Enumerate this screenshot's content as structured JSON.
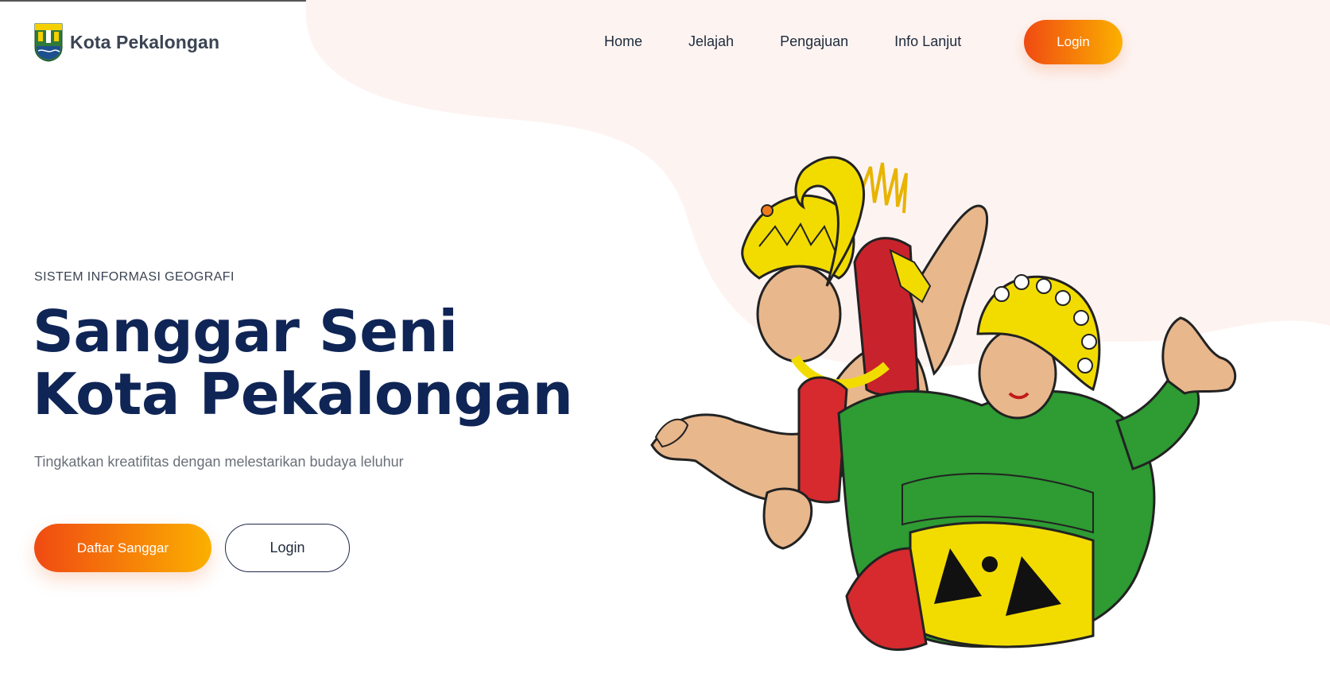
{
  "header": {
    "brand_name": "Kota Pekalongan",
    "nav": [
      {
        "label": "Home"
      },
      {
        "label": "Jelajah"
      },
      {
        "label": "Pengajuan"
      },
      {
        "label": "Info Lanjut"
      }
    ],
    "login_label": "Login"
  },
  "hero": {
    "eyebrow": "SISTEM INFORMASI GEOGRAFI",
    "title_line1": "Sanggar Seni",
    "title_line2": "Kota Pekalongan",
    "subtitle": "Tingkatkan kreatifitas dengan melestarikan budaya leluhur",
    "primary_button": "Daftar Sanggar",
    "secondary_button": "Login"
  },
  "colors": {
    "accent_gradient_start": "#f04a12",
    "accent_gradient_end": "#fbb000",
    "title_navy": "#0f2556",
    "blob_bg": "#fdf4f2"
  },
  "icons": {
    "brand_logo": "city-crest-icon",
    "hero_illustration": "traditional-dancers-illustration"
  }
}
